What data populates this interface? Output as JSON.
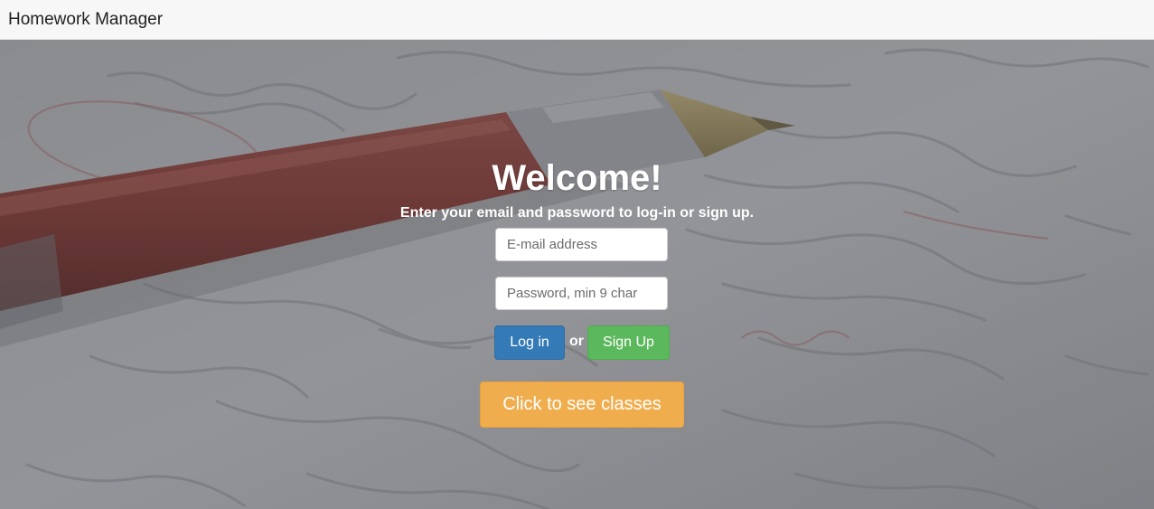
{
  "app": {
    "brand": "Homework Manager"
  },
  "hero": {
    "title": "Welcome!",
    "subtitle": "Enter your email and password to log-in or sign up.",
    "email_placeholder": "E-mail address",
    "password_placeholder": "Password, min 9 char",
    "login_label": "Log in",
    "or_label": "or",
    "signup_label": "Sign Up",
    "classes_label": "Click to see classes"
  },
  "colors": {
    "navbar_bg": "#f7f7f7",
    "login_btn": "#337ab7",
    "signup_btn": "#5cb85c",
    "classes_btn": "#f0ad4e",
    "overlay": "#8e8f93"
  },
  "background_image": "pen-on-graded-paper"
}
